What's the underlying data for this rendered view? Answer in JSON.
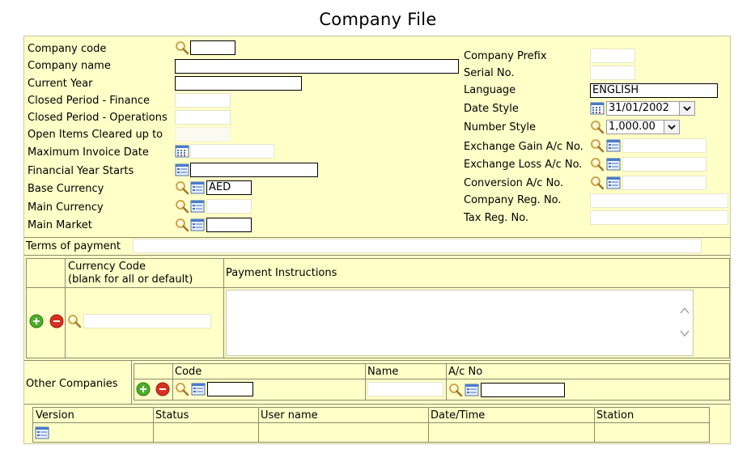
{
  "page_title": "Company File",
  "left_fields": {
    "company_code": {
      "label": "Company code",
      "value": ""
    },
    "company_name": {
      "label": "Company name",
      "value": ""
    },
    "current_year": {
      "label": "Current Year",
      "value": ""
    },
    "closed_period_finance": {
      "label": "Closed Period - Finance",
      "value": ""
    },
    "closed_period_operations": {
      "label": "Closed Period - Operations",
      "value": ""
    },
    "open_items_cleared": {
      "label": "Open Items Cleared up to",
      "value": ""
    },
    "max_invoice_date": {
      "label": "Maximum Invoice Date",
      "value": ""
    },
    "financial_year_starts": {
      "label": "Financial Year Starts",
      "value": ""
    },
    "base_currency": {
      "label": "Base Currency",
      "value": "AED"
    },
    "main_currency": {
      "label": "Main Currency",
      "value": ""
    },
    "main_market": {
      "label": "Main Market",
      "value": ""
    }
  },
  "right_fields": {
    "company_prefix": {
      "label": "Company Prefix",
      "value": ""
    },
    "serial_no": {
      "label": "Serial No.",
      "value": ""
    },
    "language": {
      "label": "Language",
      "value": "ENGLISH"
    },
    "date_style": {
      "label": "Date Style",
      "value": "31/01/2002"
    },
    "number_style": {
      "label": "Number Style",
      "value": "1,000.00"
    },
    "exchange_gain": {
      "label": "Exchange Gain A/c No.",
      "value": ""
    },
    "exchange_loss": {
      "label": "Exchange Loss A/c No.",
      "value": ""
    },
    "conversion": {
      "label": "Conversion A/c No.",
      "value": ""
    },
    "company_reg": {
      "label": "Company Reg. No.",
      "value": ""
    },
    "tax_reg": {
      "label": "Tax Reg. No.",
      "value": ""
    }
  },
  "terms": {
    "label": "Terms of payment",
    "value": ""
  },
  "payment_table": {
    "col_currency_line1": "Currency Code",
    "col_currency_line2": "(blank for all or default)",
    "col_instructions": "Payment Instructions"
  },
  "other_companies": {
    "label": "Other Companies",
    "col_code": "Code",
    "col_name": "Name",
    "col_acno": "A/c No"
  },
  "version_table": {
    "col_version": "Version",
    "col_status": "Status",
    "col_user": "User name",
    "col_datetime": "Date/Time",
    "col_station": "Station"
  },
  "icons": {
    "lookup": "magnifier-icon",
    "calendar": "calendar-icon",
    "list": "list-icon",
    "add": "add-icon",
    "remove": "remove-icon"
  },
  "colors": {
    "panel_bg": "#ffffc8",
    "add_green": "#4caf28",
    "remove_red": "#d83020"
  }
}
